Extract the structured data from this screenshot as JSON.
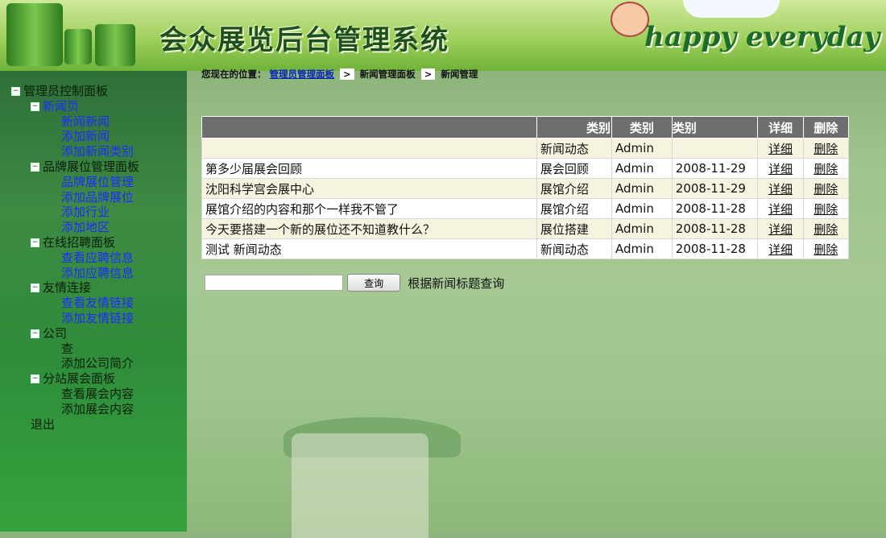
{
  "header": {
    "system_title": "会众展览后台管理系统",
    "slogan": "happy everyday"
  },
  "breadcrumb": {
    "prefix": "您现在的位置：",
    "items": [
      "管理员管理面板",
      "新闻管理面板",
      "新闻管理"
    ],
    "separator": ">"
  },
  "sidebar": {
    "root": "管理员控制面板",
    "groups": [
      {
        "label": "新闻页",
        "items": [
          "新闻新闻",
          "添加新闻",
          "添加新闻类别"
        ],
        "link": true
      },
      {
        "label": "品牌展位管理面板",
        "items": [
          "品牌展位管理",
          "添加品牌展位",
          "添加行业",
          "添加地区"
        ],
        "link": false
      },
      {
        "label": "在线招聘面板",
        "items": [
          "查看应聘信息",
          "添加应聘信息"
        ],
        "link": false
      },
      {
        "label": "友情连接",
        "items": [
          "查看友情链接",
          "添加友情链接"
        ],
        "link": false
      },
      {
        "label": "公司",
        "items": [
          "查",
          "添加公司简介"
        ],
        "link": false
      },
      {
        "label": "分站展会面板",
        "items": [
          "查看展会内容",
          "添加展会内容"
        ],
        "link": false
      }
    ],
    "exit": "退出"
  },
  "table": {
    "headers": [
      "",
      "类别",
      "类别",
      "类别",
      "详细",
      "删除"
    ],
    "rows": [
      {
        "title": "",
        "category": "新闻动态",
        "author": "Admin",
        "date": "",
        "detail": "详细",
        "delete": "删除"
      },
      {
        "title": "第多少届展会回顾",
        "category": "展会回顾",
        "author": "Admin",
        "date": "2008-11-29",
        "detail": "详细",
        "delete": "删除"
      },
      {
        "title": "沈阳科学宫会展中心",
        "category": "展馆介绍",
        "author": "Admin",
        "date": "2008-11-29",
        "detail": "详细",
        "delete": "删除"
      },
      {
        "title": "展馆介绍的内容和那个一样我不管了",
        "category": "展馆介绍",
        "author": "Admin",
        "date": "2008-11-28",
        "detail": "详细",
        "delete": "删除"
      },
      {
        "title": "今天要搭建一个新的展位还不知道教什么？",
        "category": "展位搭建",
        "author": "Admin",
        "date": "2008-11-28",
        "detail": "详细",
        "delete": "删除"
      },
      {
        "title": "测试 新闻动态",
        "category": "新闻动态",
        "author": "Admin",
        "date": "2008-11-28",
        "detail": "详细",
        "delete": "删除"
      }
    ]
  },
  "search": {
    "input_value": "",
    "button_label": "查询",
    "hint": "根据新闻标题查询"
  }
}
